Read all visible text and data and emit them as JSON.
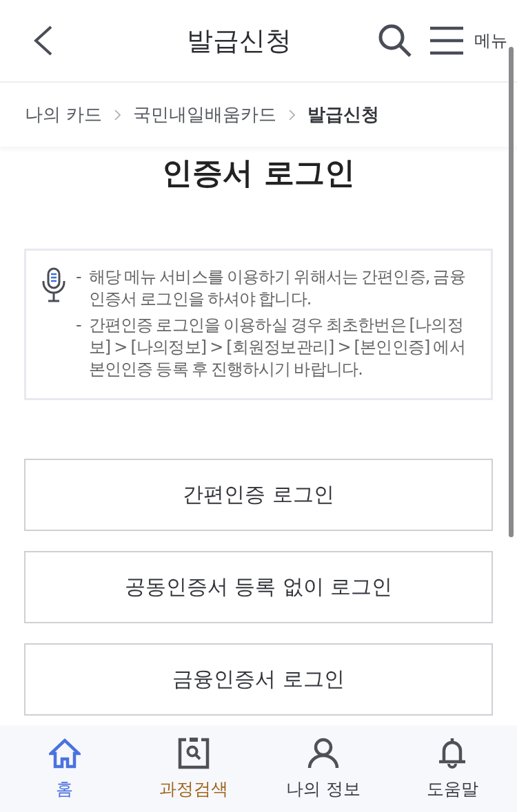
{
  "header": {
    "title": "발급신청",
    "menu_label": "메뉴"
  },
  "breadcrumb": [
    {
      "label": "나의 카드",
      "current": false
    },
    {
      "label": "국민내일배움카드",
      "current": false
    },
    {
      "label": "발급신청",
      "current": true
    }
  ],
  "page_title": "인증서 로그인",
  "notice": {
    "items": [
      {
        "marker": "-",
        "text": "해당 메뉴 서비스를 이용하기 위해서는 간편인증, 금융인증서 로그인을 하셔야 합니다."
      },
      {
        "marker": "-",
        "text": "간편인증 로그인을 이용하실 경우 최초한번은 [나의정보] > [나의정보] > [회원정보관리] > [본인인증] 에서 본인인증 등록 후 진행하시기 바랍니다."
      }
    ]
  },
  "login_buttons": [
    "간편인증 로그인",
    "공동인증서 등록 없이 로그인",
    "금융인증서 로그인"
  ],
  "bottom_nav": [
    {
      "kind": "home",
      "label": "홈",
      "selected": true,
      "highlighted": false
    },
    {
      "kind": "course-search",
      "label": "과정검색",
      "selected": false,
      "highlighted": true
    },
    {
      "kind": "profile",
      "label": "나의 정보",
      "selected": false,
      "highlighted": false
    },
    {
      "kind": "help",
      "label": "도움말",
      "selected": false,
      "highlighted": false
    }
  ]
}
